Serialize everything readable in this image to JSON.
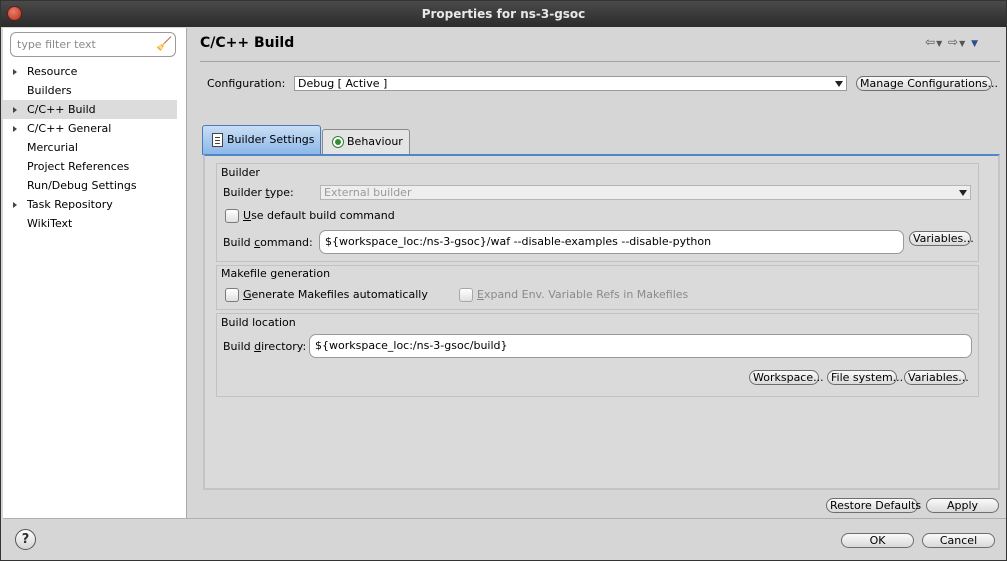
{
  "window": {
    "title": "Properties for ns-3-gsoc"
  },
  "sidebar": {
    "filter_placeholder": "type filter text",
    "items": [
      {
        "label": "Resource",
        "expandable": true
      },
      {
        "label": "Builders",
        "expandable": false
      },
      {
        "label": "C/C++ Build",
        "expandable": true,
        "selected": true
      },
      {
        "label": "C/C++ General",
        "expandable": true
      },
      {
        "label": "Mercurial",
        "expandable": false
      },
      {
        "label": "Project References",
        "expandable": false
      },
      {
        "label": "Run/Debug Settings",
        "expandable": false
      },
      {
        "label": "Task Repository",
        "expandable": true
      },
      {
        "label": "WikiText",
        "expandable": false
      }
    ]
  },
  "page": {
    "title": "C/C++ Build",
    "configuration_label": "Configuration:",
    "configuration_value": "Debug  [ Active ]",
    "manage_button": "Manage Configurations..."
  },
  "tabs": [
    {
      "label": "Builder Settings",
      "active": true
    },
    {
      "label": "Behaviour",
      "active": false
    }
  ],
  "builder": {
    "group_title": "Builder",
    "type_label_prefix": "Builder ",
    "type_label_u": "t",
    "type_label_suffix": "ype:",
    "type_value": "External builder",
    "use_default_u": "U",
    "use_default_rest": "se default build command",
    "command_label_prefix": "Build ",
    "command_label_u": "c",
    "command_label_suffix": "ommand:",
    "command_value": "${workspace_loc:/ns-3-gsoc}/waf --disable-examples --disable-python",
    "variables_button": "Variables..."
  },
  "makefile": {
    "group_title": "Makefile generation",
    "generate_u": "G",
    "generate_rest": "enerate Makefiles automatically",
    "expand_u": "E",
    "expand_rest": "xpand Env. Variable Refs in Makefiles"
  },
  "location": {
    "group_title": "Build location",
    "directory_label_prefix": "Build ",
    "directory_label_u": "d",
    "directory_label_suffix": "irectory:",
    "directory_value": "${workspace_loc:/ns-3-gsoc/build}",
    "workspace_button": "Workspace...",
    "filesystem_button": "File system...",
    "variables_button": "Variables..."
  },
  "footer": {
    "restore_defaults": "Restore Defaults",
    "apply": "Apply",
    "ok": "OK",
    "cancel": "Cancel",
    "help": "?"
  }
}
